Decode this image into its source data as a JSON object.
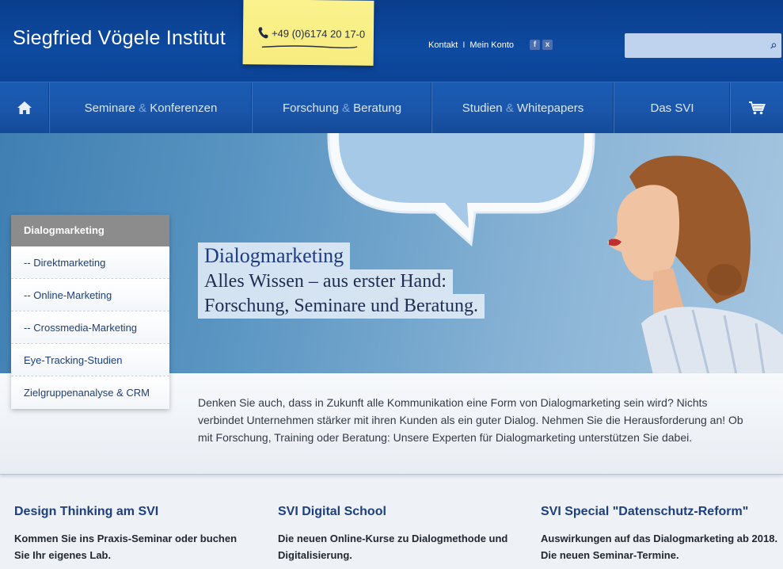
{
  "header": {
    "logo": "Siegfried Vögele Institut",
    "phone": "+49 (0)6174 20 17-0",
    "links": [
      "Kontakt",
      "Mein Konto"
    ],
    "link_separator": "I",
    "search_placeholder": ""
  },
  "nav": {
    "items": [
      {
        "a": "Seminare",
        "amp": "&",
        "b": "Konferenzen"
      },
      {
        "a": "Forschung",
        "amp": "&",
        "b": "Beratung"
      },
      {
        "a": "Studien",
        "amp": "&",
        "b": "Whitepapers"
      },
      {
        "a": "Das SVI",
        "amp": "",
        "b": ""
      }
    ]
  },
  "hero": {
    "title": "Dialogmarketing",
    "line2": "Alles Wissen – aus erster Hand:",
    "line3": "Forschung, Seminare und Beratung."
  },
  "submenu": {
    "head": "Dialogmarketing",
    "items": [
      "-- Direktmarketing",
      "-- Online-Marketing",
      "-- Crossmedia-Marketing",
      "Eye-Tracking-Studien",
      "Zielgruppenanalyse & CRM"
    ]
  },
  "intro": "Denken Sie auch, dass in Zukunft alle Kommunikation eine Form von Dialogmarketing sein wird? Nichts verbindet Unternehmen stärker mit ihren Kunden als ein guter Dialog. Nehmen Sie die Herausforderung an! Ob mit Forschung, Training oder Beratung: Unsere Experten für Dialogmarketing unterstützen Sie dabei.",
  "teasers": [
    {
      "title": "Design Thinking am SVI",
      "text": "Kommen Sie ins Praxis-Seminar oder buchen Sie Ihr eigenes Lab."
    },
    {
      "title": "SVI Digital School",
      "text": "Die neuen Online-Kurse zu Dialogmethode und Digitalisierung."
    },
    {
      "title": "SVI Special \"Datenschutz-Reform\"",
      "text": "Auswirkungen auf das Dialogmarketing ab 2018. Die neuen Seminar-Termine."
    }
  ]
}
